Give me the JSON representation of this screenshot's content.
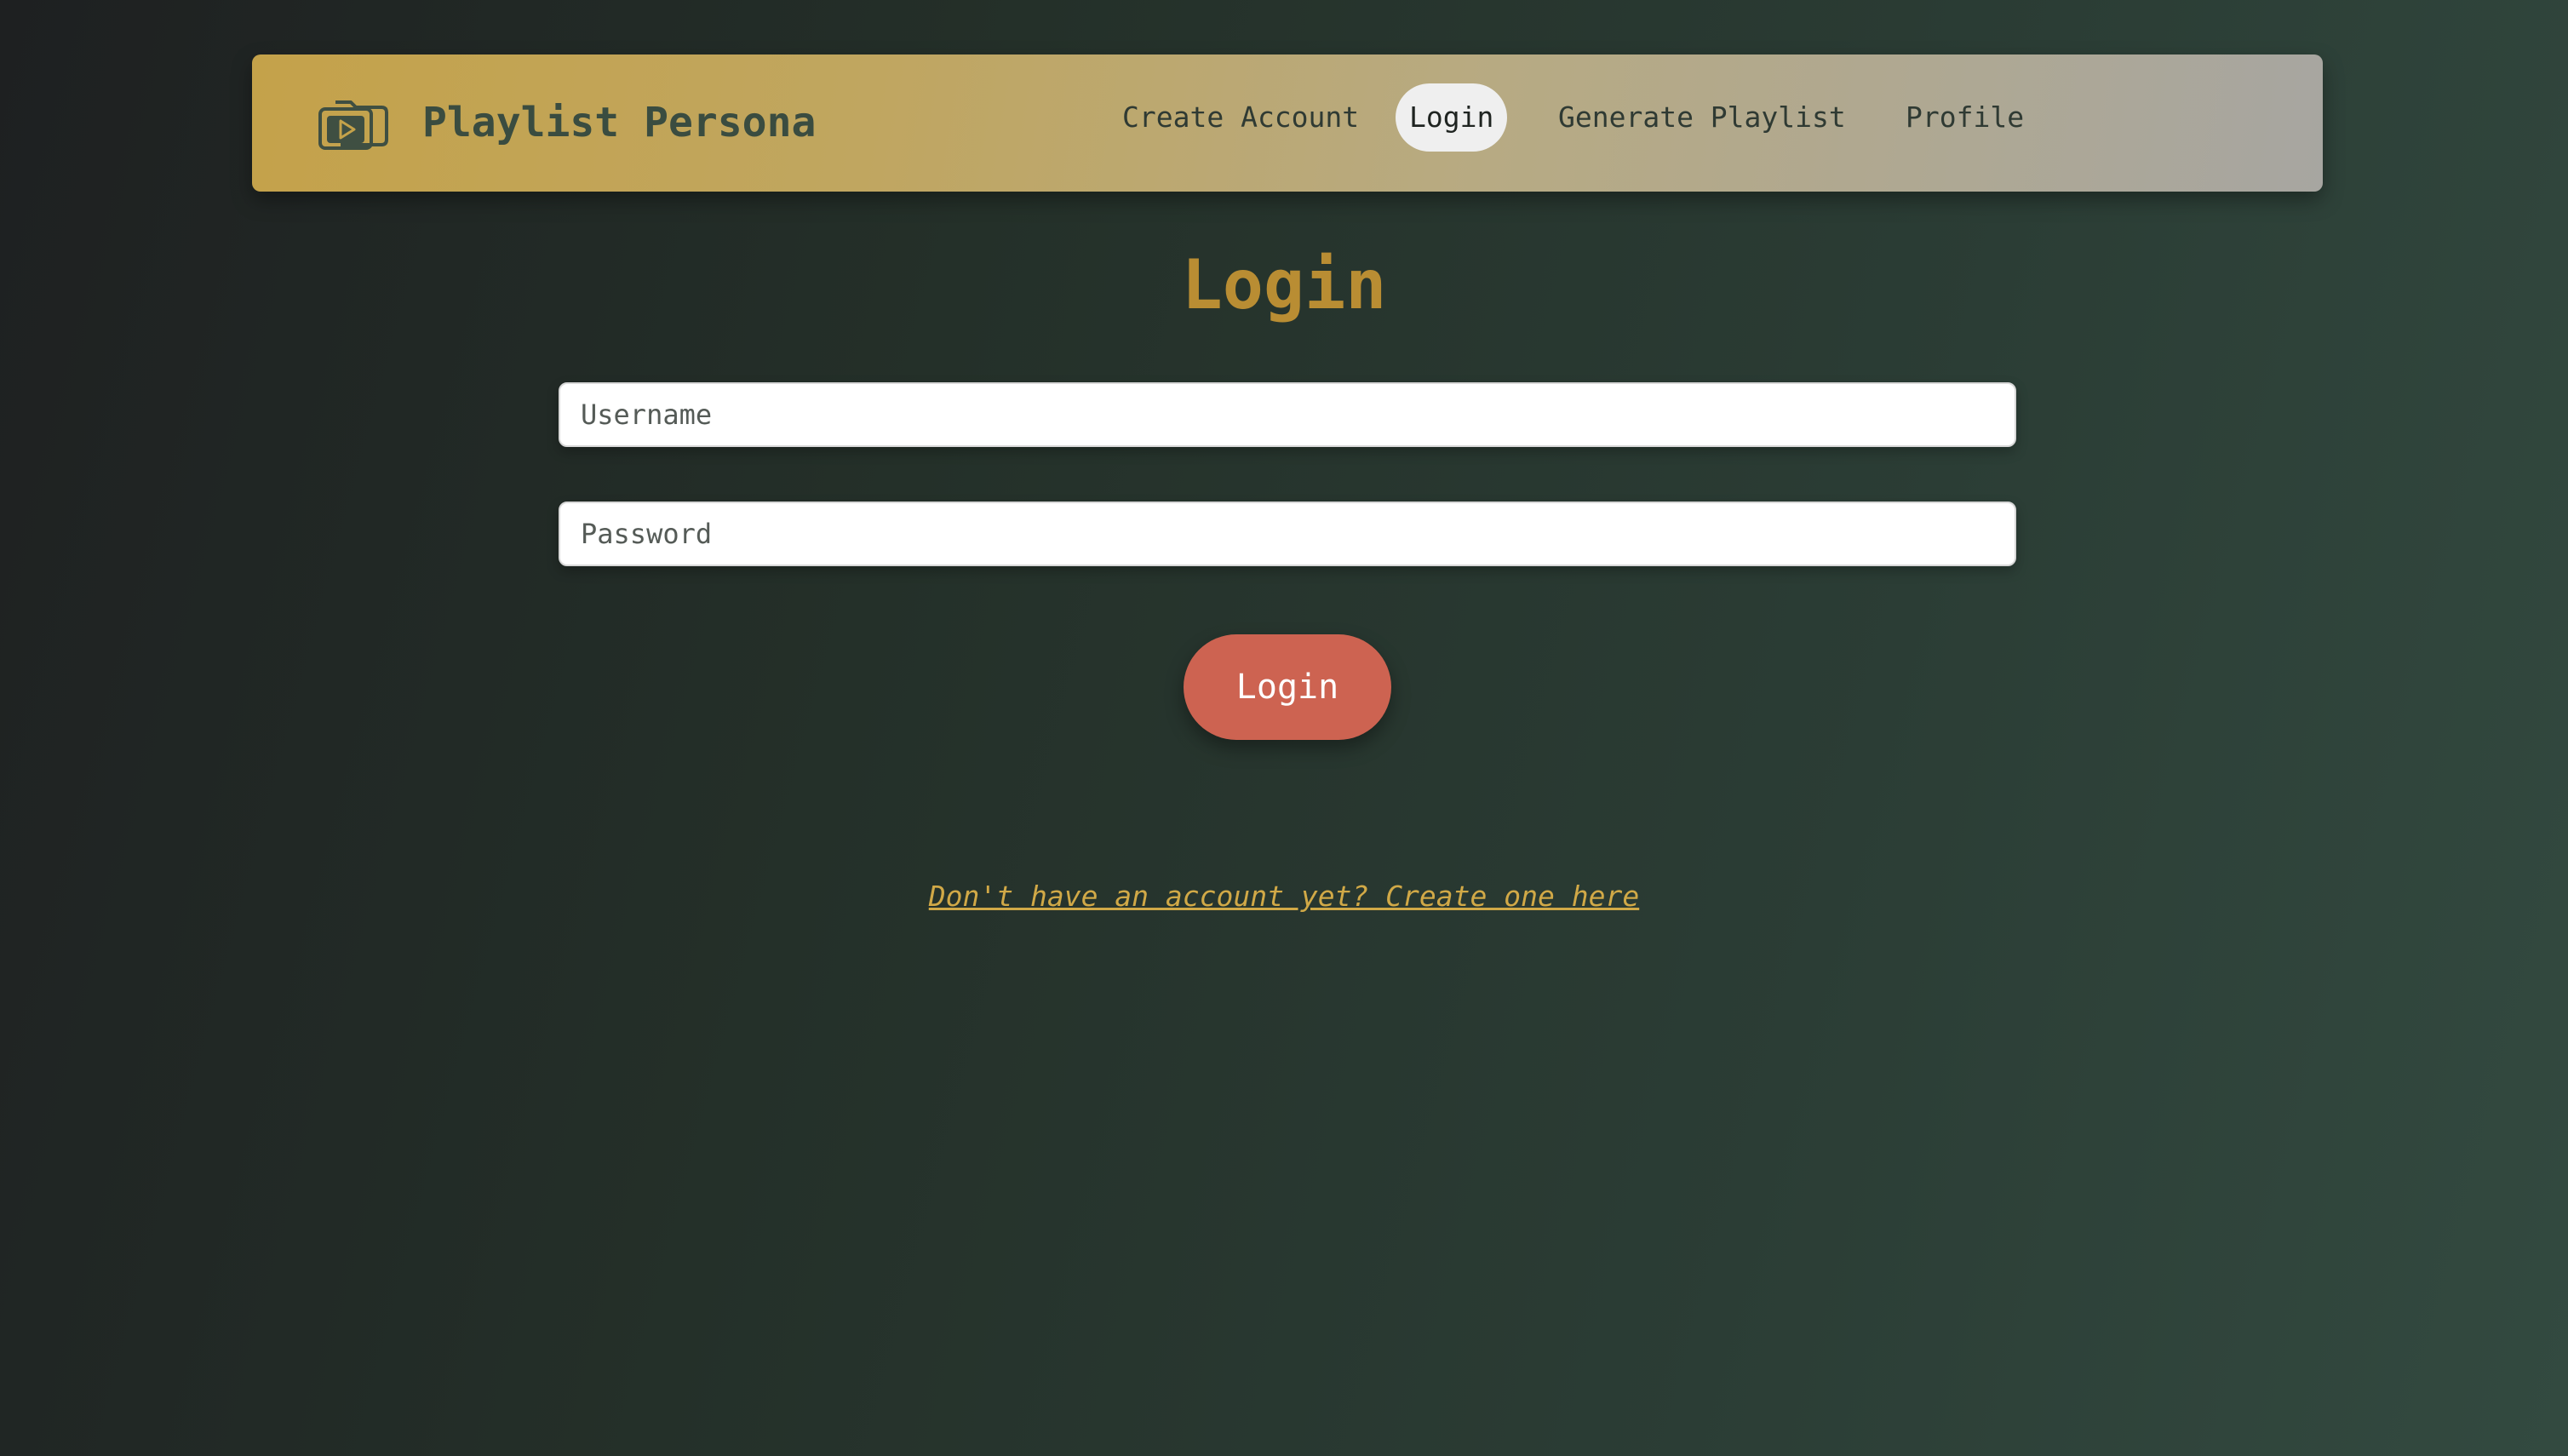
{
  "header": {
    "brand_icon": "playlist-folder-icon",
    "brand_title": "Playlist Persona",
    "nav": [
      {
        "label": "Create Account",
        "active": false
      },
      {
        "label": "Login",
        "active": true
      },
      {
        "label": "Generate Playlist",
        "active": false
      },
      {
        "label": "Profile",
        "active": false
      }
    ]
  },
  "main": {
    "title": "Login",
    "username_placeholder": "Username",
    "password_placeholder": "Password",
    "submit_label": "Login",
    "create_account_link": "Don't have an account yet? Create one here"
  },
  "colors": {
    "title": "#b98d33",
    "button": "#cd6351",
    "link": "#d1a947",
    "brand_text": "#3a4c40"
  }
}
